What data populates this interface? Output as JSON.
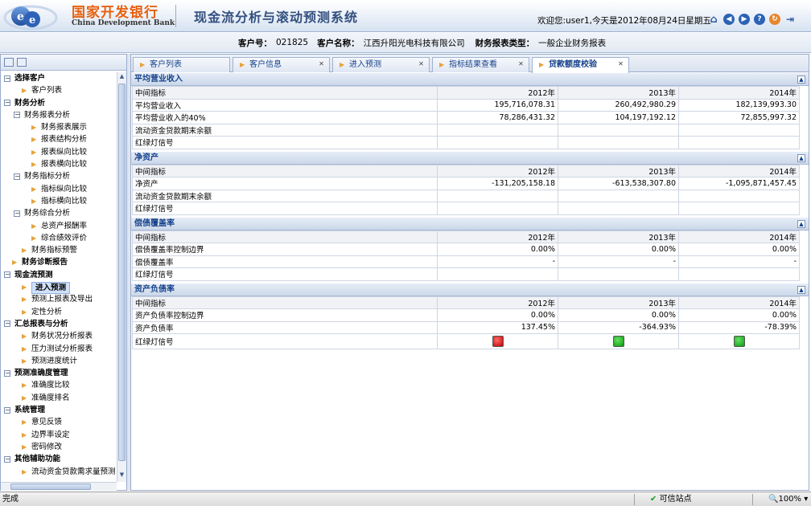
{
  "header": {
    "bank_cn": "国家开发银行",
    "bank_en": "China Development Bank",
    "system_title": "现金流分析与滚动预测系统",
    "welcome": "欢迎您:user1,今天是2012年08月24日星期五",
    "icons": [
      "home-icon",
      "back-icon",
      "forward-icon",
      "help-icon",
      "refresh-icon",
      "logout-icon"
    ]
  },
  "info": {
    "customer_no_label": "客户号：",
    "customer_no": "021825",
    "customer_name_label": "客户名称：",
    "customer_name": "江西升阳光电科技有限公司",
    "report_type_label": "财务报表类型：",
    "report_type": "一般企业财务报表"
  },
  "tree": [
    {
      "label": "选择客户",
      "level": 0,
      "bold": true,
      "toggle": "⊟"
    },
    {
      "label": "客户列表",
      "level": 1
    },
    {
      "label": "财务分析",
      "level": 0,
      "bold": true,
      "toggle": "⊟"
    },
    {
      "label": "财务报表分析",
      "level": 1,
      "toggle": "⊟"
    },
    {
      "label": "财务报表展示",
      "level": 2
    },
    {
      "label": "报表结构分析",
      "level": 2
    },
    {
      "label": "报表纵向比较",
      "level": 2
    },
    {
      "label": "报表横向比较",
      "level": 2
    },
    {
      "label": "财务指标分析",
      "level": 1,
      "toggle": "⊟"
    },
    {
      "label": "指标纵向比较",
      "level": 2
    },
    {
      "label": "指标横向比较",
      "level": 2
    },
    {
      "label": "财务综合分析",
      "level": 1,
      "toggle": "⊟"
    },
    {
      "label": "总资产报酬率",
      "level": 2
    },
    {
      "label": "综合绩效评价",
      "level": 2
    },
    {
      "label": "财务指标预警",
      "level": 1
    },
    {
      "label": "财务诊断报告",
      "level": 0,
      "bold": true
    },
    {
      "label": "现金流预测",
      "level": 0,
      "bold": true,
      "toggle": "⊟"
    },
    {
      "label": "进入预测",
      "level": 1,
      "selected": true
    },
    {
      "label": "预测上报表及导出",
      "level": 1
    },
    {
      "label": "定性分析",
      "level": 1
    },
    {
      "label": "汇总报表与分析",
      "level": 0,
      "bold": true,
      "toggle": "⊟"
    },
    {
      "label": "财务状况分析报表",
      "level": 1
    },
    {
      "label": "压力测试分析报表",
      "level": 1
    },
    {
      "label": "预测进度统计",
      "level": 1
    },
    {
      "label": "预测准确度管理",
      "level": 0,
      "bold": true,
      "toggle": "⊟"
    },
    {
      "label": "准确度比较",
      "level": 1
    },
    {
      "label": "准确度排名",
      "level": 1
    },
    {
      "label": "系统管理",
      "level": 0,
      "bold": true,
      "toggle": "⊟"
    },
    {
      "label": "意见反馈",
      "level": 1
    },
    {
      "label": "边界率设定",
      "level": 1
    },
    {
      "label": "密码修改",
      "level": 1
    },
    {
      "label": "其他辅助功能",
      "level": 0,
      "bold": true,
      "toggle": "⊟"
    },
    {
      "label": "流动资金贷款需求量预测",
      "level": 1
    }
  ],
  "tabs": [
    {
      "label": "客户列表",
      "closable": false,
      "active": false
    },
    {
      "label": "客户信息",
      "closable": true,
      "active": false
    },
    {
      "label": "进入预测",
      "closable": true,
      "active": false
    },
    {
      "label": "指标结果查看",
      "closable": true,
      "active": false
    },
    {
      "label": "贷款额度校验",
      "closable": true,
      "active": true
    }
  ],
  "sections": [
    {
      "title": "平均营业收入",
      "header": [
        "中间指标",
        "2012年",
        "2013年",
        "2014年"
      ],
      "rows": [
        [
          "平均营业收入",
          "195,716,078.31",
          "260,492,980.29",
          "182,139,993.30"
        ],
        [
          "平均营业收入的40%",
          "78,286,431.32",
          "104,197,192.12",
          "72,855,997.32"
        ],
        [
          "流动资金贷款期末余额",
          "",
          "",
          ""
        ],
        [
          "红绿灯信号",
          "",
          "",
          ""
        ]
      ]
    },
    {
      "title": "净资产",
      "header": [
        "中间指标",
        "2012年",
        "2013年",
        "2014年"
      ],
      "rows": [
        [
          "净资产",
          "-131,205,158.18",
          "-613,538,307.80",
          "-1,095,871,457.45"
        ],
        [
          "流动资金贷款期末余额",
          "",
          "",
          ""
        ],
        [
          "红绿灯信号",
          "",
          "",
          ""
        ]
      ]
    },
    {
      "title": "偿债覆盖率",
      "header": [
        "中间指标",
        "2012年",
        "2013年",
        "2014年"
      ],
      "rows": [
        [
          "偿债覆盖率控制边界",
          "0.00%",
          "0.00%",
          "0.00%"
        ],
        [
          "偿债覆盖率",
          "-",
          "-",
          "-"
        ],
        [
          "红绿灯信号",
          "",
          "",
          ""
        ]
      ]
    },
    {
      "title": "资产负债率",
      "header": [
        "中间指标",
        "2012年",
        "2013年",
        "2014年"
      ],
      "rows": [
        [
          "资产负债率控制边界",
          "0.00%",
          "0.00%",
          "0.00%"
        ],
        [
          "资产负债率",
          "137.45%",
          "-364.93%",
          "-78.39%"
        ],
        [
          "红绿灯信号",
          "",
          "",
          ""
        ]
      ],
      "signals": [
        "red",
        "green",
        "green"
      ]
    }
  ],
  "status": {
    "left": "完成",
    "zone": "可信站点",
    "zoom": "100%"
  },
  "colors": {
    "bank_orange": "#e8600f",
    "title_blue": "#33507f",
    "signal_red": "#c00000",
    "signal_green": "#0a9a0a"
  }
}
